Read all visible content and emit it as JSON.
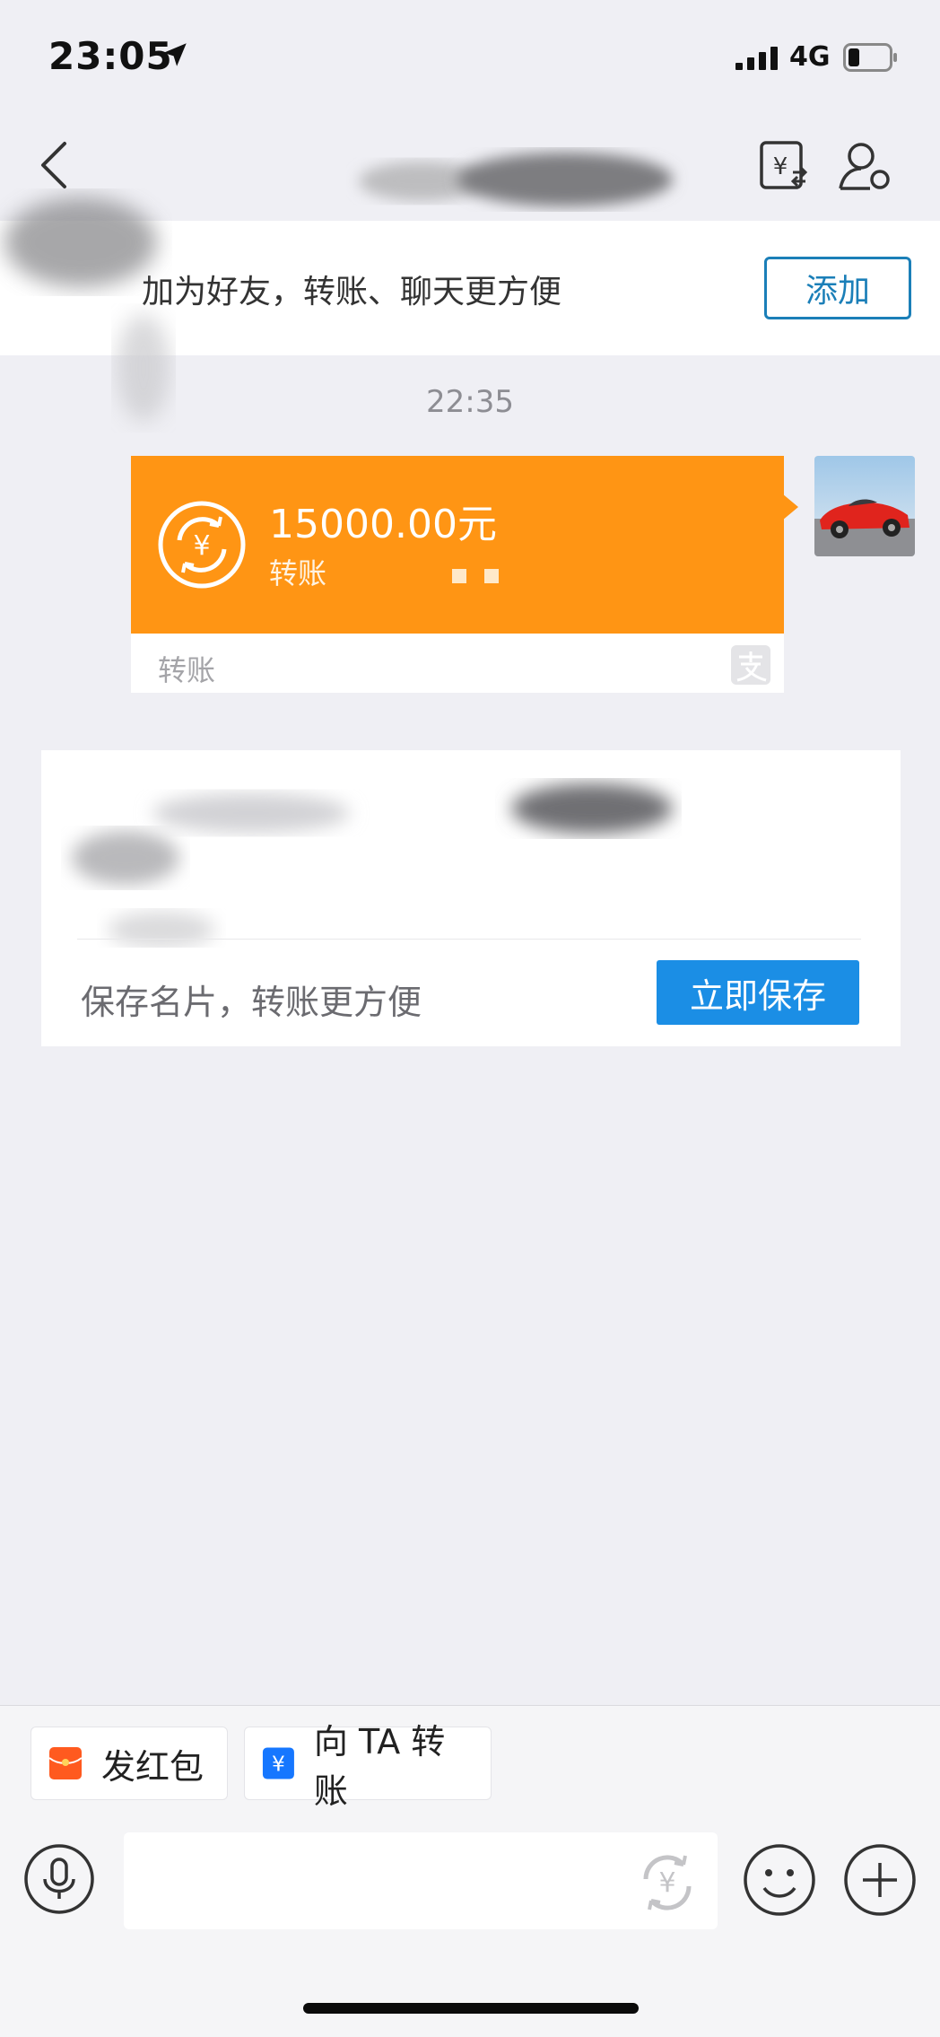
{
  "status_bar": {
    "time": "23:05",
    "network": "4G"
  },
  "banner": {
    "text": "加为好友，转账、聊天更方便",
    "add_label": "添加"
  },
  "chat": {
    "timestamp": "22:35",
    "transfer_card": {
      "amount": "15000.00元",
      "subtitle": "转账",
      "footer": "转账",
      "color": "#ff9514"
    }
  },
  "save_card": {
    "text": "保存名片，转账更方便",
    "save_label": "立即保存",
    "button_color": "#1b8ee5"
  },
  "quick_actions": [
    {
      "label": "发红包",
      "icon": "red-envelope-icon",
      "color": "#ff5a1f"
    },
    {
      "label": "向 TA 转账",
      "icon": "transfer-icon",
      "color": "#1677ff"
    }
  ],
  "input_bar": {
    "placeholder": ""
  }
}
